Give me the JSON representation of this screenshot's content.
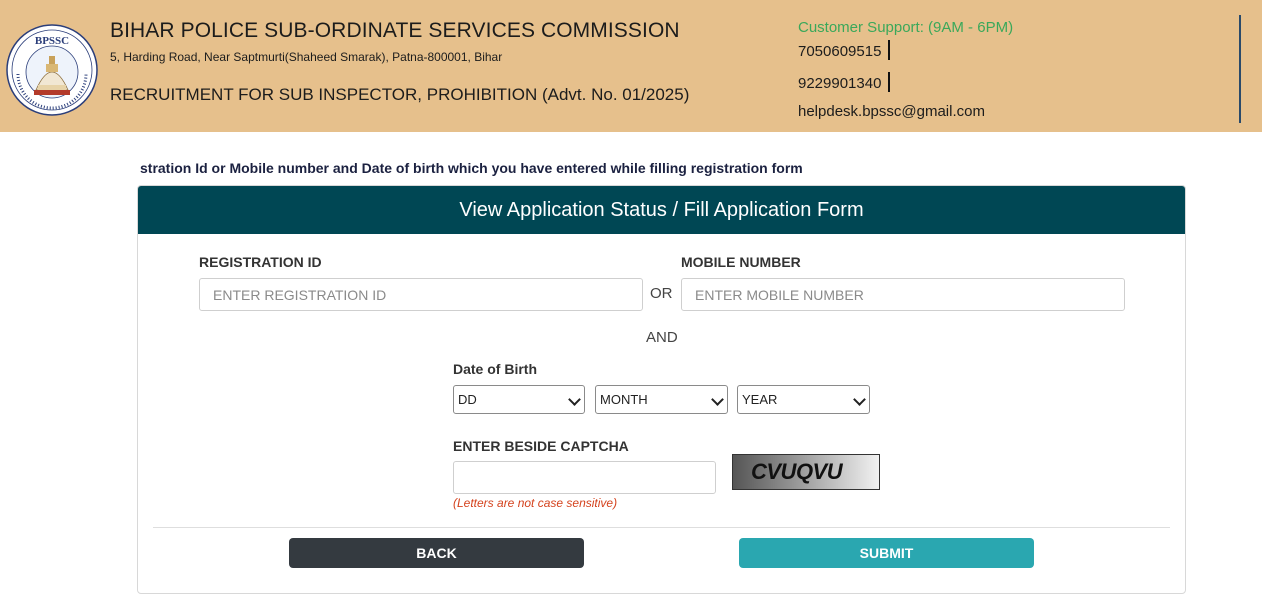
{
  "header": {
    "logo_text": "BPSSC",
    "logo_ring_text": "BIHAR POLICE SUB-ORDINATE SERVICES COMMISSION",
    "org_title": "BIHAR POLICE SUB-ORDINATE SERVICES COMMISSION",
    "address": "5, Harding Road, Near Saptmurti(Shaheed Smarak), Patna-800001, Bihar",
    "recruitment": "RECRUITMENT FOR SUB INSPECTOR, PROHIBITION (Advt. No. 01/2025)",
    "support_title": "Customer Support: (9AM - 6PM)",
    "phones": [
      "7050609515",
      "9229901340"
    ],
    "email": "helpdesk.bpssc@gmail.com"
  },
  "notice": "stration Id or Mobile number and Date of birth which you have entered while filling registration form",
  "form": {
    "title": "View Application Status / Fill Application Form",
    "registration_label": "REGISTRATION ID",
    "registration_placeholder": "ENTER REGISTRATION ID",
    "or_text": "OR",
    "mobile_label": "MOBILE NUMBER",
    "mobile_placeholder": "ENTER MOBILE NUMBER",
    "and_text": "AND",
    "dob_label": "Date of Birth",
    "dob": {
      "day": "DD",
      "month": "MONTH",
      "year": "YEAR"
    },
    "captcha_label": "ENTER BESIDE CAPTCHA",
    "captcha_value": "",
    "captcha_code": "CVUQVU",
    "captcha_hint": "(Letters are not case sensitive)",
    "back_label": "BACK",
    "submit_label": "SUBMIT"
  },
  "colors": {
    "header_bg": "#e6c08c",
    "card_header_bg": "#004754",
    "support_green": "#3aa85a",
    "back_button": "#343a40",
    "submit_button": "#2aa7b0",
    "hint_red": "#d4421d"
  }
}
